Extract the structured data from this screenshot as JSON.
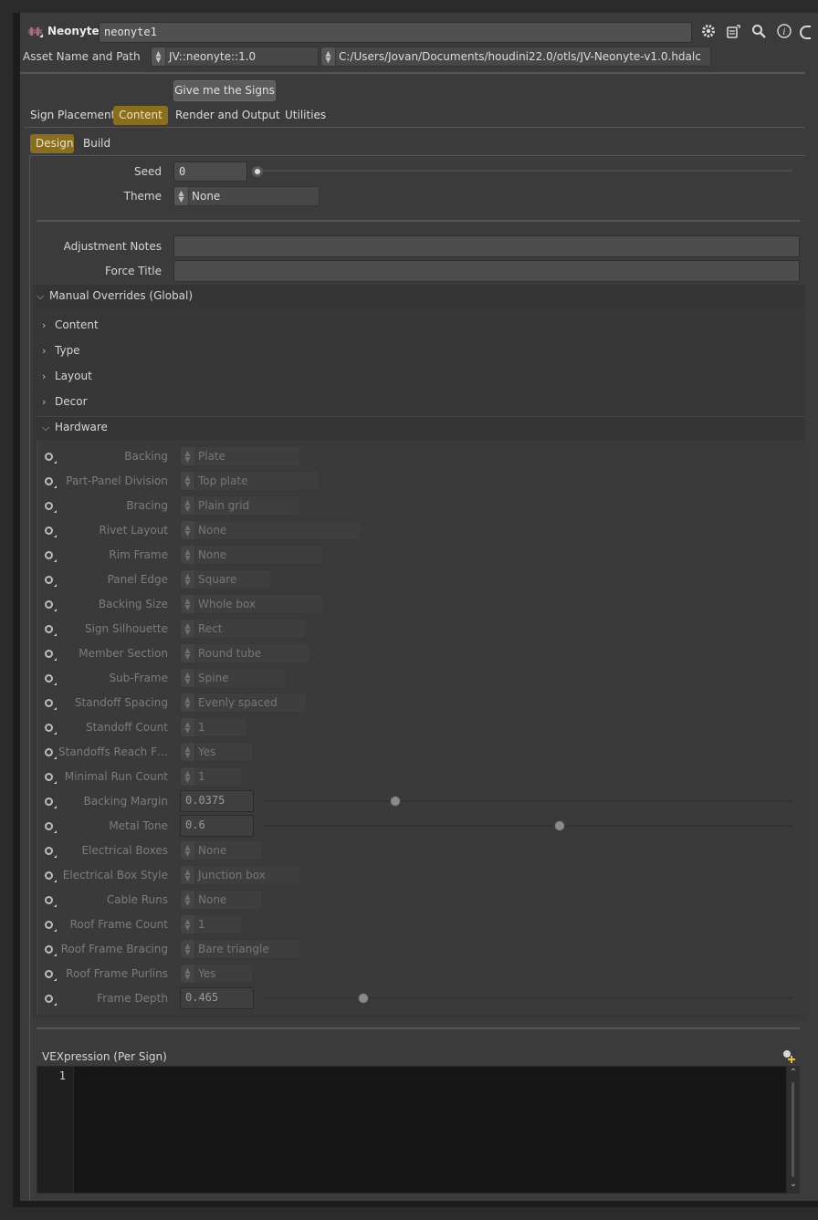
{
  "node": {
    "type_label": "Neonyte",
    "name": "neonyte1"
  },
  "asset": {
    "label": "Asset Name and Path",
    "name": "JV::neonyte::1.0",
    "path": "C:/Users/Jovan/Documents/houdini22.0/otls/JV-Neonyte-v1.0.hdalc"
  },
  "action_button": "Give me the Signs",
  "main_tabs": [
    "Sign Placement",
    "Content",
    "Render and Output",
    "Utilities"
  ],
  "sub_tabs": [
    "Design",
    "Build"
  ],
  "design": {
    "seed_label": "Seed",
    "seed_value": "0",
    "theme_label": "Theme",
    "theme_value": "None",
    "adjustment_notes_label": "Adjustment Notes",
    "adjustment_notes_value": "",
    "force_title_label": "Force Title",
    "force_title_value": ""
  },
  "overrides": {
    "title": "Manual Overrides (Global)",
    "collapsed_folders": [
      "Content",
      "Type",
      "Layout",
      "Decor"
    ],
    "hardware_title": "Hardware"
  },
  "hardware_params": [
    {
      "label": "Backing",
      "kind": "menu",
      "value": "Plate"
    },
    {
      "label": "Part-Panel Division",
      "kind": "menu",
      "value": "Top plate"
    },
    {
      "label": "Bracing",
      "kind": "menu",
      "value": "Plain grid"
    },
    {
      "label": "Rivet Layout",
      "kind": "menu",
      "value": "None"
    },
    {
      "label": "Rim Frame",
      "kind": "menu",
      "value": "None"
    },
    {
      "label": "Panel Edge",
      "kind": "menu",
      "value": "Square"
    },
    {
      "label": "Backing Size",
      "kind": "menu",
      "value": "Whole box"
    },
    {
      "label": "Sign Silhouette",
      "kind": "menu",
      "value": "Rect"
    },
    {
      "label": "Member Section",
      "kind": "menu",
      "value": "Round tube"
    },
    {
      "label": "Sub-Frame",
      "kind": "menu",
      "value": "Spine"
    },
    {
      "label": "Standoff Spacing",
      "kind": "menu",
      "value": "Evenly spaced"
    },
    {
      "label": "Standoff Count",
      "kind": "menu",
      "value": "1"
    },
    {
      "label": "Standoffs Reach F…",
      "kind": "menu",
      "value": "Yes"
    },
    {
      "label": "Minimal Run Count",
      "kind": "menu",
      "value": "1"
    },
    {
      "label": "Backing Margin",
      "kind": "slider",
      "value": "0.0375",
      "fraction": 0.25
    },
    {
      "label": "Metal Tone",
      "kind": "slider",
      "value": "0.6",
      "fraction": 0.56
    },
    {
      "label": "Electrical Boxes",
      "kind": "menu",
      "value": "None"
    },
    {
      "label": "Electrical Box Style",
      "kind": "menu",
      "value": "Junction box"
    },
    {
      "label": "Cable Runs",
      "kind": "menu",
      "value": "None"
    },
    {
      "label": "Roof Frame Count",
      "kind": "menu",
      "value": "1"
    },
    {
      "label": "Roof Frame Bracing",
      "kind": "menu",
      "value": "Bare triangle"
    },
    {
      "label": "Roof Frame Purlins",
      "kind": "menu",
      "value": "Yes"
    },
    {
      "label": "Frame Depth",
      "kind": "slider",
      "value": "0.465",
      "fraction": 0.19
    }
  ],
  "vex": {
    "label": "VEXpression (Per Sign)",
    "line_number": "1",
    "code": ""
  },
  "colors": {
    "accent": "#8a6e1f",
    "panel": "#3b3b3b",
    "editor": "#161616"
  },
  "icons": [
    "node-type-icon",
    "gear-icon",
    "asset-icon",
    "search-icon",
    "info-icon"
  ]
}
